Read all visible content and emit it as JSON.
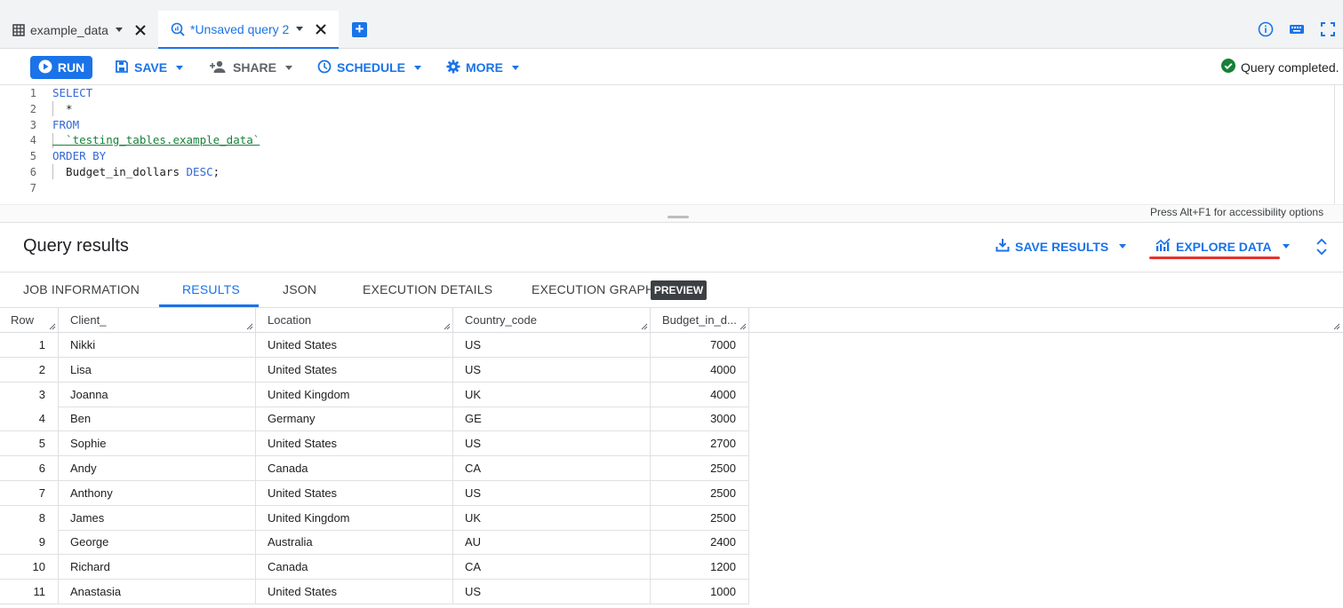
{
  "tabs": {
    "dataset_tab": "example_data",
    "query_tab": "*Unsaved query 2",
    "add_label": "+"
  },
  "toolbar": {
    "run": "RUN",
    "save": "SAVE",
    "share": "SHARE",
    "schedule": "SCHEDULE",
    "more": "MORE",
    "status": "Query completed."
  },
  "editor": {
    "lines": [
      {
        "n": "1",
        "text": "SELECT",
        "kind": "kw"
      },
      {
        "n": "2",
        "text": "  *",
        "kind": "plain"
      },
      {
        "n": "3",
        "text": "FROM",
        "kind": "kw"
      },
      {
        "n": "4",
        "text": "  `testing_tables.example_data`",
        "kind": "str"
      },
      {
        "n": "5",
        "text": "ORDER BY",
        "kind": "kw"
      },
      {
        "n": "6",
        "text": "  Budget_in_dollars",
        "suffix_kw": " DESC",
        "suffix": ";",
        "kind": "mixed"
      },
      {
        "n": "7",
        "text": "",
        "kind": "plain"
      }
    ],
    "accessibility_hint": "Press Alt+F1 for accessibility options"
  },
  "results": {
    "title": "Query results",
    "save_results": "SAVE RESULTS",
    "explore_data": "EXPLORE DATA",
    "subtabs": [
      "JOB INFORMATION",
      "RESULTS",
      "JSON",
      "EXECUTION DETAILS",
      "EXECUTION GRAPH"
    ],
    "preview_badge": "PREVIEW",
    "active_subtab": "RESULTS"
  },
  "table": {
    "columns": [
      "Row",
      "Client_",
      "Location",
      "Country_code",
      "Budget_in_d..."
    ],
    "rows": [
      [
        "1",
        "Nikki",
        "United States",
        "US",
        "7000"
      ],
      [
        "2",
        "Lisa",
        "United States",
        "US",
        "4000"
      ],
      [
        "3",
        "Joanna",
        "United Kingdom",
        "UK",
        "4000"
      ],
      [
        "4",
        "Ben",
        "Germany",
        "GE",
        "3000"
      ],
      [
        "5",
        "Sophie",
        "United States",
        "US",
        "2700"
      ],
      [
        "6",
        "Andy",
        "Canada",
        "CA",
        "2500"
      ],
      [
        "7",
        "Anthony",
        "United States",
        "US",
        "2500"
      ],
      [
        "8",
        "James",
        "United Kingdom",
        "UK",
        "2500"
      ],
      [
        "9",
        "George",
        "Australia",
        "AU",
        "2400"
      ],
      [
        "10",
        "Richard",
        "Canada",
        "CA",
        "1200"
      ],
      [
        "11",
        "Anastasia",
        "United States",
        "US",
        "1000"
      ]
    ]
  },
  "colors": {
    "accent": "#1a73e8",
    "success": "#188038",
    "highlight_underline": "#e8302c"
  }
}
